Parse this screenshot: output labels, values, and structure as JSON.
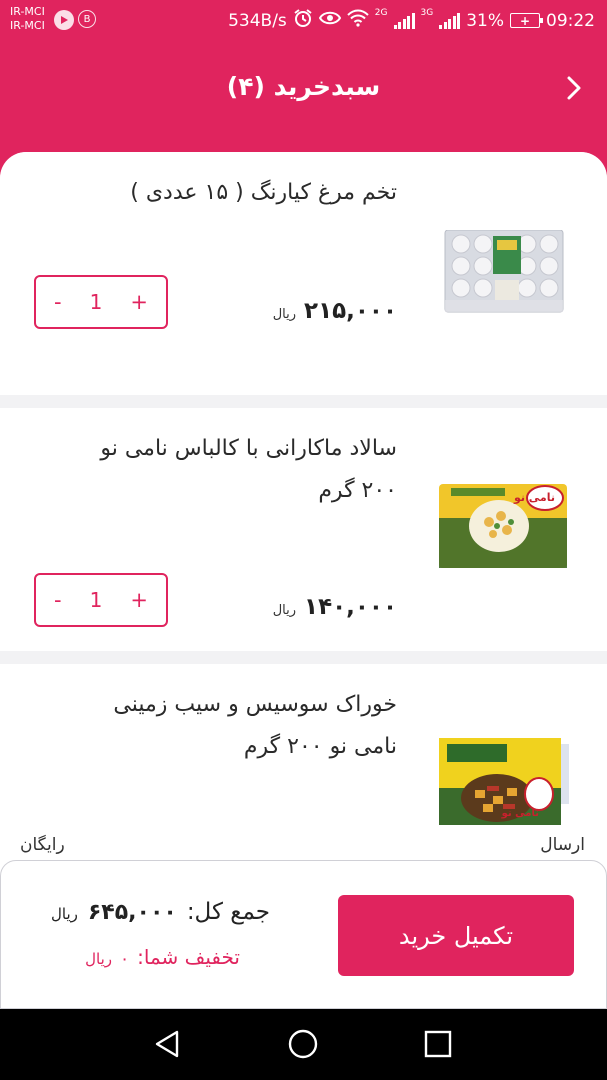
{
  "status_bar": {
    "carrier_line1": "IR-MCI",
    "carrier_line2": "IR-MCI",
    "b_badge": "B",
    "net_speed": "534B/s",
    "net_type_1": "2G",
    "net_type_2": "3G",
    "battery_percent": "31%",
    "time": "09:22",
    "icons": [
      "play-icon",
      "alarm-icon",
      "eye-icon",
      "wifi-icon",
      "signal-icon",
      "battery-icon"
    ]
  },
  "header": {
    "title": "سبدخرید (۴)",
    "back_icon": "chevron-right-icon"
  },
  "items": [
    {
      "name": "تخم مرغ کیارنگ ( ۱۵ عددی )",
      "price": "۲۱۵,۰۰۰",
      "currency": "ریال",
      "quantity": "1",
      "minus": "-",
      "plus": "+"
    },
    {
      "name": "سالاد ماکارانی با کالباس نامی نو ۲۰۰ گرم",
      "price": "۱۴۰,۰۰۰",
      "currency": "ریال",
      "quantity": "1",
      "minus": "-",
      "plus": "+",
      "thumb_brand": "نامی نو"
    },
    {
      "name": "خوراک سوسیس و سیب زمینی نامی نو ۲۰۰ گرم",
      "thumb_brand": "نامی نو"
    }
  ],
  "shipping": {
    "label": "ارسال",
    "value": "رایگان"
  },
  "summary": {
    "total_label": "جمع کل:",
    "total_amount": "۶۴۵,۰۰۰",
    "total_currency": "ریال",
    "discount_label": "تخفیف شما:",
    "discount_amount": "۰",
    "discount_currency": "ریال",
    "checkout_label": "تکمیل خرید"
  },
  "colors": {
    "brand": "#e0245e",
    "background": "#f2f2f4"
  }
}
